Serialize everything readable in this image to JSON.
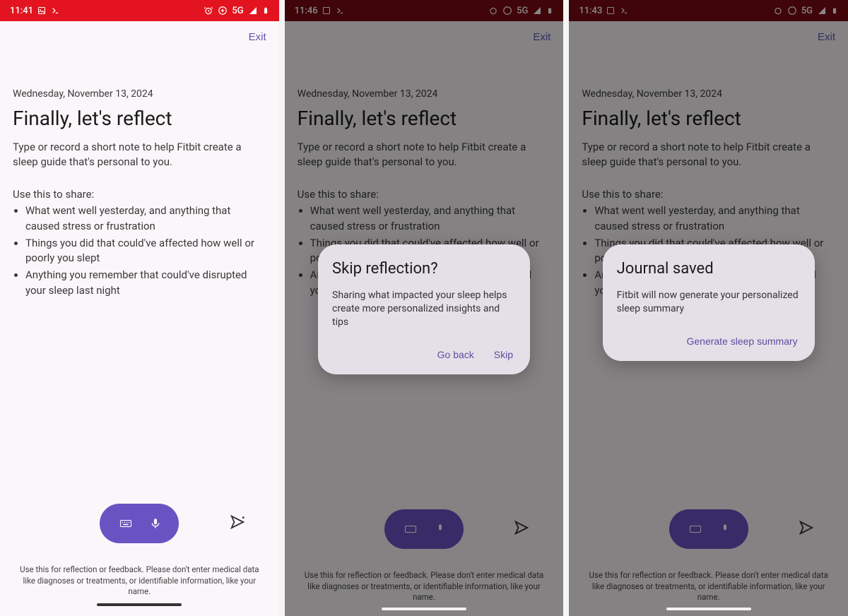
{
  "screens": [
    {
      "status": {
        "time": "11:41",
        "network": "5G"
      },
      "exit": "Exit",
      "date": "Wednesday, November 13, 2024",
      "title": "Finally, let's reflect",
      "intro": "Type or record a short note to help Fitbit create a sleep guide that's personal to you.",
      "share_label": "Use this to share:",
      "bullets": [
        "What went well yesterday, and anything that caused stress or frustration",
        "Things you did that could've affected how well or poorly you slept",
        "Anything you remember that could've disrupted your sleep last night"
      ],
      "disclaimer": "Use this for reflection or feedback. Please don't enter medical data like diagnoses or treatments, or identifiable information, like your name."
    },
    {
      "status": {
        "time": "11:46",
        "network": "5G"
      },
      "exit": "Exit",
      "date": "Wednesday, November 13, 2024",
      "title": "Finally, let's reflect",
      "intro": "Type or record a short note to help Fitbit create a sleep guide that's personal to you.",
      "share_label": "Use this to share:",
      "bullets": [
        "What went well yesterday, and anything that caused stress or frustration",
        "Things you did that could've affected how well or poorly you slept",
        "Anything you remember that could've disrupted your sleep last night"
      ],
      "disclaimer": "Use this for reflection or feedback. Please don't enter medical data like diagnoses or treatments, or identifiable information, like your name.",
      "dialog": {
        "title": "Skip reflection?",
        "body": "Sharing what impacted your sleep helps create more personalized insights and tips",
        "actions": [
          "Go back",
          "Skip"
        ]
      }
    },
    {
      "status": {
        "time": "11:43",
        "network": "5G"
      },
      "exit": "Exit",
      "date": "Wednesday, November 13, 2024",
      "title": "Finally, let's reflect",
      "intro": "Type or record a short note to help Fitbit create a sleep guide that's personal to you.",
      "share_label": "Use this to share:",
      "bullets": [
        "What went well yesterday, and anything that caused stress or frustration",
        "Things you did that could've affected how well or poorly you slept",
        "Anything you remember that could've disrupted your sleep last night"
      ],
      "disclaimer": "Use this for reflection or feedback. Please don't enter medical data like diagnoses or treatments, or identifiable information, like your name.",
      "dialog": {
        "title": "Journal saved",
        "body": "Fitbit will now generate your personalized sleep summary",
        "actions": [
          "Generate sleep summary"
        ]
      }
    }
  ]
}
